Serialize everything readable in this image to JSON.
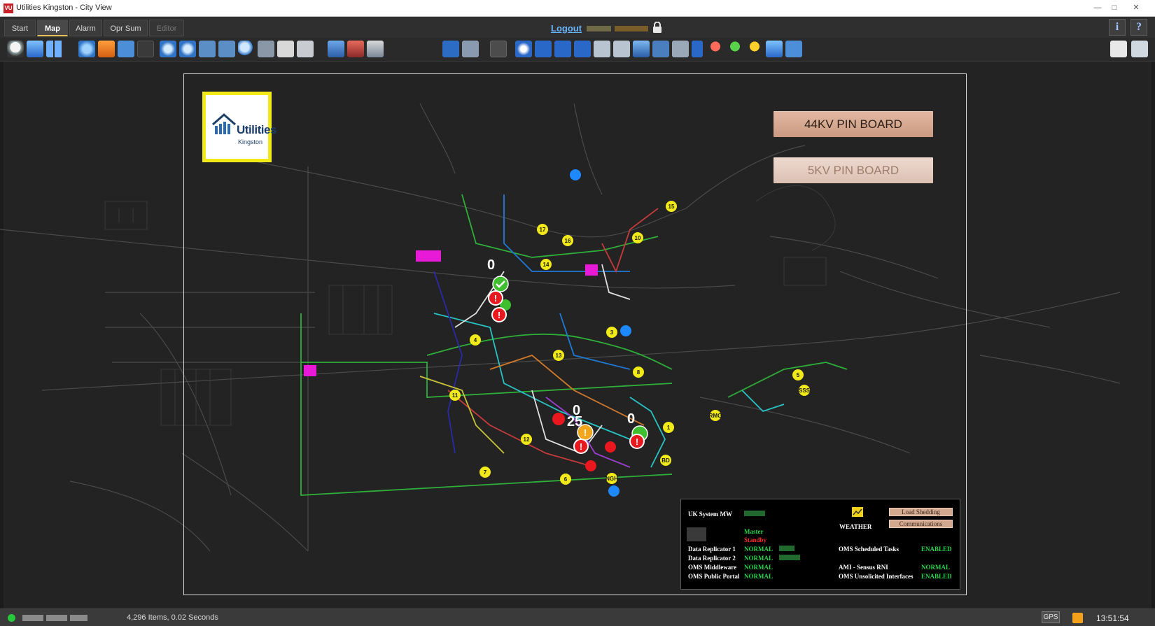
{
  "window": {
    "title": "Utilities Kingston - City View",
    "app_icon": "VU"
  },
  "tabs": [
    {
      "label": "Start",
      "state": "normal"
    },
    {
      "label": "Map",
      "state": "active"
    },
    {
      "label": "Alarm",
      "state": "normal"
    },
    {
      "label": "Opr Sum",
      "state": "normal"
    },
    {
      "label": "Editor",
      "state": "disabled"
    }
  ],
  "header": {
    "logout_label": "Logout",
    "info_glyph": "i",
    "help_glyph": "?"
  },
  "toolbar_icons": [
    "bell-icon",
    "folder-open-icon",
    "grid-layout-icon",
    "globe-icon",
    "home-icon",
    "back-arrow-icon",
    "forward-arrow-icon",
    "zoom-in-icon",
    "zoom-out-icon",
    "crop-icon",
    "pan-icon",
    "magnifier-icon",
    "3d-view-icon",
    "print-icon",
    "report-icon",
    "oms-tools-icon",
    "dms-icon",
    "layer-down-icon",
    "vu-logo-icon",
    "list-icon",
    "measure-icon",
    "compass-icon",
    "trace-up-icon",
    "trace-down-icon",
    "trace-loop-icon",
    "panel-icon",
    "table-icon",
    "warning-icon",
    "truck-icon",
    "checklist-icon",
    "chevron-right-icon",
    "red-pin-icon",
    "green-pin-icon",
    "yellow-pin-icon",
    "lightning-icon",
    "chevron-down-icon"
  ],
  "toolbar_right_icons": [
    "trend-chart-icon",
    "export-icon"
  ],
  "logo": {
    "brand": "Utilities",
    "sub": "Kingston"
  },
  "pin_boards": [
    {
      "label": "44KV PIN BOARD",
      "state": "enabled"
    },
    {
      "label": "5KV PIN BOARD",
      "state": "disabled"
    }
  ],
  "map": {
    "feeder_colors": [
      "#2fae3a",
      "#1f7ad6",
      "#c43b3b",
      "#e0e0e0",
      "#d07a2a",
      "#28c4c4",
      "#2a2aa8",
      "#c8c238",
      "#9b3fd1"
    ],
    "substation_labels": [
      "17",
      "16",
      "10",
      "15",
      "14",
      "4",
      "3",
      "13",
      "8",
      "11",
      "12",
      "1",
      "7",
      "6",
      "BD",
      "5",
      "SSS",
      "RMG",
      "NGH"
    ],
    "incident_counts": [
      "0",
      "0",
      "25",
      "0"
    ],
    "marker_colors": {
      "substation": "#f2ea18",
      "info": "#1e88ff",
      "outage": "#e8181e",
      "restored": "#3fbf2f",
      "warning": "#f2a61b",
      "label_box": "#e81ad8"
    }
  },
  "status_panel": {
    "uk_system_mw_label": "UK System MW",
    "weather_label": "WEATHER",
    "load_shedding_label": "Load Shedding",
    "communications_label": "Communications",
    "master_label": "Master",
    "standby_label": "Standby",
    "rows_left": [
      {
        "label": "Data Replicator 1",
        "value": "NORMAL"
      },
      {
        "label": "Data Replicator 2",
        "value": "NORMAL"
      },
      {
        "label": "OMS Middleware",
        "value": "NORMAL"
      },
      {
        "label": "OMS Public Portal",
        "value": "NORMAL"
      }
    ],
    "rows_right": [
      {
        "label": "OMS Scheduled Tasks",
        "value": "ENABLED"
      },
      {
        "label": "AMI - Sensus RNI",
        "value": "NORMAL"
      },
      {
        "label": "OMS Unsolicited Interfaces",
        "value": "ENABLED"
      }
    ]
  },
  "statusbar": {
    "items_text": "4,296 Items, 0.02 Seconds",
    "gps_label": "GPS",
    "clock": "13:51:54"
  }
}
